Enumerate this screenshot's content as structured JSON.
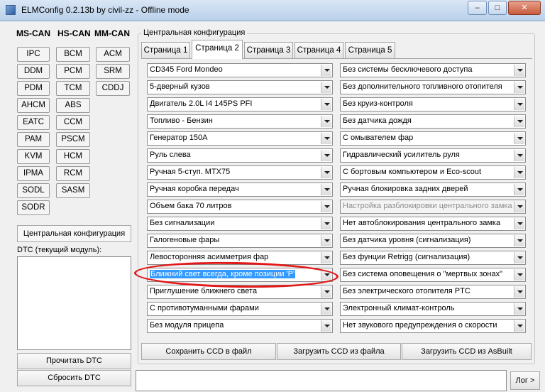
{
  "window": {
    "title": "ELMConfig 0.2.13b by civil-zz - Offline mode",
    "minimize": "–",
    "maximize": "□",
    "close": "✕"
  },
  "modules": {
    "ms_can_header": "MS-CAN",
    "hs_can_header": "HS-CAN",
    "mm_can_header": "MM-CAN",
    "ms_can": [
      "IPC",
      "DDM",
      "PDM",
      "AHCM",
      "EATC",
      "PAM",
      "KVM",
      "IPMA",
      "SODL",
      "SODR"
    ],
    "hs_can": [
      "BCM",
      "PCM",
      "TCM",
      "ABS",
      "CCM",
      "PSCM",
      "HCM",
      "RCM",
      "SASM"
    ],
    "mm_can": [
      "ACM",
      "SRM",
      "CDDJ"
    ]
  },
  "left_panel": {
    "central_config": "Центральная конфигурация",
    "dtc_label": "DTC (текущий модуль):",
    "read_dtc": "Прочитать DTC",
    "clear_dtc": "Сбросить DTC"
  },
  "config": {
    "group_title": "Центральная конфигурация",
    "tabs": [
      "Страница 1",
      "Страница 2",
      "Страница 3",
      "Страница 4",
      "Страница 5"
    ],
    "active_tab": "Страница 2",
    "left_combos": [
      "CD345 Ford Mondeo",
      "5-дверный кузов",
      "Двигатель 2.0L I4 145PS PFI",
      "Топливо - Бензин",
      "Генератор 150А",
      "Руль слева",
      "Ручная 5-ступ. MTX75",
      "Ручная коробка передач",
      "Объем бака 70 литров",
      "Без сигнализации",
      "Галогеновые фары",
      "Левосторонняя асимметрия фар",
      "Ближний свет всегда, кроме позиции 'P'",
      "Приглушение ближнего света",
      "С противотуманными фарами",
      "Без модуля прицепа"
    ],
    "right_combos": [
      "Без системы бесключевого доступа",
      "Без дополнительного топливного отопителя",
      "Без круиз-контроля",
      "Без датчика дождя",
      "С омывателем фар",
      "Гидравлический усилитель руля",
      "С бортовым компьютером и Eco-scout",
      "Ручная блокировка задних дверей",
      "Настройка разблокировки центрального замка",
      "Нет автоблокирования центрального замка",
      "Без датчика уровня (сигнализация)",
      "Без фунции Retrigg (сигнализация)",
      "Без система оповещения о \"мертвых зонах\"",
      "Без электрического отопителя PTC",
      "Электронный климат-контроль",
      "Нет звукового предупреждения о скорости"
    ],
    "save_to_file": "Сохранить CCD в файл",
    "load_from_file": "Загрузить CCD из файла",
    "load_from_asbuilt": "Загрузить CCD из AsBuilt"
  },
  "log_button": "Лог >"
}
